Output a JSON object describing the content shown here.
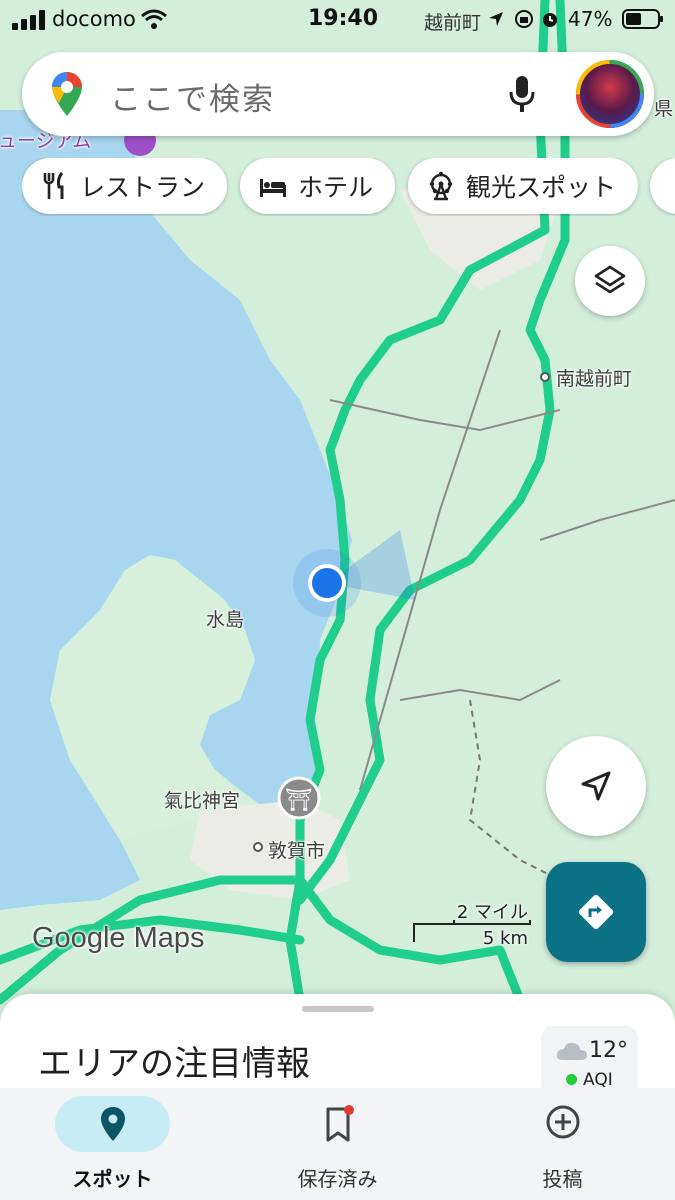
{
  "status_bar": {
    "carrier": "docomo",
    "time": "19:40",
    "location": "越前町",
    "battery": "47%"
  },
  "search": {
    "placeholder": "ここで検索"
  },
  "chips": [
    {
      "label": "レストラン",
      "icon": "fork-knife-icon"
    },
    {
      "label": "ホテル",
      "icon": "bed-icon"
    },
    {
      "label": "観光スポット",
      "icon": "ferris-wheel-icon"
    }
  ],
  "map": {
    "labels": {
      "minami_echizen": "南越前町",
      "mizushima": "水島",
      "kehi_jingu": "氣比神宮",
      "tsuruga": "敦賀市",
      "museum_partial": "ュージアム",
      "pref_partial": "県"
    },
    "watermark": "Google Maps",
    "scale": {
      "miles": "2 マイル",
      "km": "5 km"
    },
    "colors": {
      "water": "#aadaff",
      "land": "#cfeedd",
      "highway": "#1fce8c",
      "location_dot": "#1a73e8"
    }
  },
  "sheet": {
    "title": "エリアの注目情報"
  },
  "weather": {
    "temp": "12°",
    "aqi": "AQI"
  },
  "nav": {
    "spot": "スポット",
    "saved": "保存済み",
    "post": "投稿"
  }
}
